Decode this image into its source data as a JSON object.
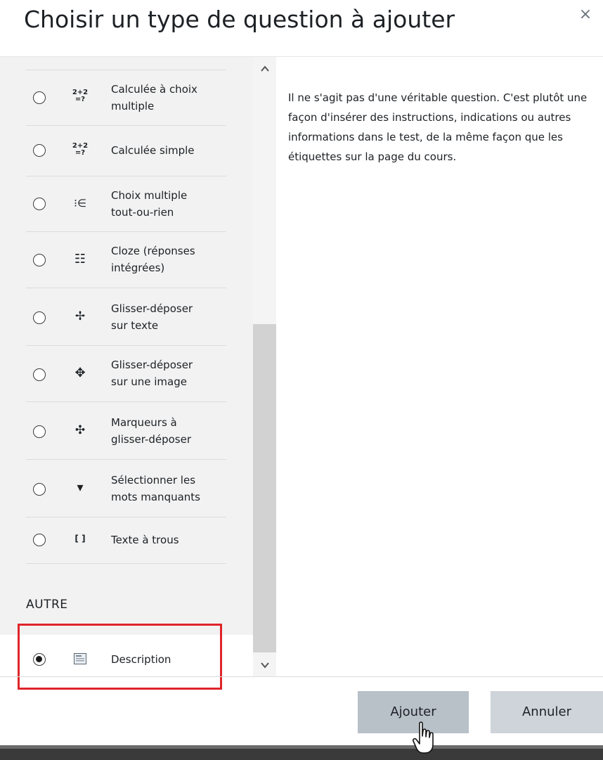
{
  "dialog": {
    "title": "Choisir un type de question à ajouter",
    "close_symbol": "×"
  },
  "question_types": [
    {
      "label_line1": "Calculée à choix",
      "label_line2": "multiple",
      "icon": "2+2\n=?",
      "icon_name": "calculated-multichoice-icon",
      "selected": false
    },
    {
      "label_line1": "Calculée simple",
      "label_line2": "",
      "icon": "2+2\n=?",
      "icon_name": "calculated-simple-icon",
      "selected": false
    },
    {
      "label_line1": "Choix multiple",
      "label_line2": "tout-ou-rien",
      "icon": "⁝∈",
      "icon_name": "multichoice-allornothing-icon",
      "selected": false
    },
    {
      "label_line1": "Cloze (réponses",
      "label_line2": "intégrées)",
      "icon": "☷",
      "icon_name": "cloze-icon",
      "selected": false
    },
    {
      "label_line1": "Glisser-déposer",
      "label_line2": "sur texte",
      "icon": "✢",
      "icon_name": "drag-drop-text-icon",
      "selected": false
    },
    {
      "label_line1": "Glisser-déposer",
      "label_line2": "sur une image",
      "icon": "✥",
      "icon_name": "drag-drop-image-icon",
      "selected": false
    },
    {
      "label_line1": "Marqueurs à",
      "label_line2": "glisser-déposer",
      "icon": "✣",
      "icon_name": "drag-drop-markers-icon",
      "selected": false
    },
    {
      "label_line1": "Sélectionner les",
      "label_line2": "mots manquants",
      "icon": "▾",
      "icon_name": "select-missing-words-icon",
      "selected": false
    },
    {
      "label_line1": "Texte à trous",
      "label_line2": "",
      "icon": "[ ]",
      "icon_name": "gapfill-icon",
      "selected": false
    }
  ],
  "other_section": {
    "heading": "AUTRE",
    "items": [
      {
        "label": "Description",
        "icon_name": "description-icon",
        "selected": true
      }
    ]
  },
  "description_text": "Il ne s'agit pas d'une véritable question. C'est plutôt une façon d'insérer des instructions, indications ou autres informations dans le test, de la même façon que les étiquettes sur la page du cours.",
  "footer": {
    "add_label": "Ajouter",
    "cancel_label": "Annuler"
  },
  "colors": {
    "highlight": "#e0242a",
    "panel_bg": "#f2f2f2",
    "button_bg": "#ced4da"
  }
}
